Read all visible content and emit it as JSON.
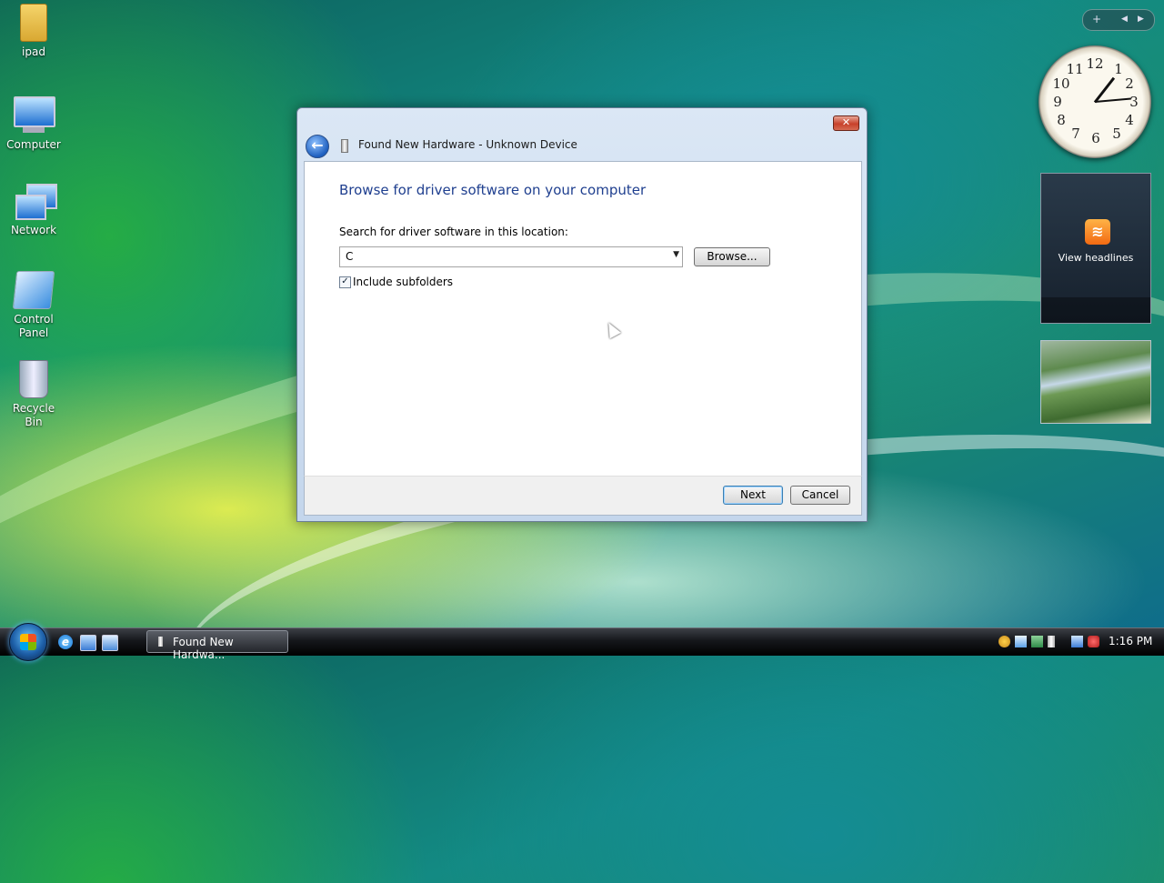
{
  "desktop": {
    "icons": [
      {
        "label": "ipad"
      },
      {
        "label": "Computer"
      },
      {
        "label": "Network"
      },
      {
        "label": "Control Panel"
      },
      {
        "label": "Recycle Bin"
      }
    ]
  },
  "dialog": {
    "title": "Found New Hardware - Unknown Device",
    "heading": "Browse for driver software on your computer",
    "search_label": "Search for driver software in this location:",
    "location_value": "C",
    "browse_label": "Browse...",
    "include_subfolders_label": "Include subfolders",
    "include_subfolders_checked": true,
    "next_label": "Next",
    "cancel_label": "Cancel",
    "close_label": "✕"
  },
  "sidebar": {
    "gadget_add": "+",
    "feed_label": "View headlines",
    "clock_numbers": [
      "12",
      "1",
      "2",
      "3",
      "4",
      "5",
      "6",
      "7",
      "8",
      "9",
      "10",
      "11"
    ]
  },
  "taskbar": {
    "task_label": "Found New Hardwa...",
    "time": "1:16 PM"
  }
}
